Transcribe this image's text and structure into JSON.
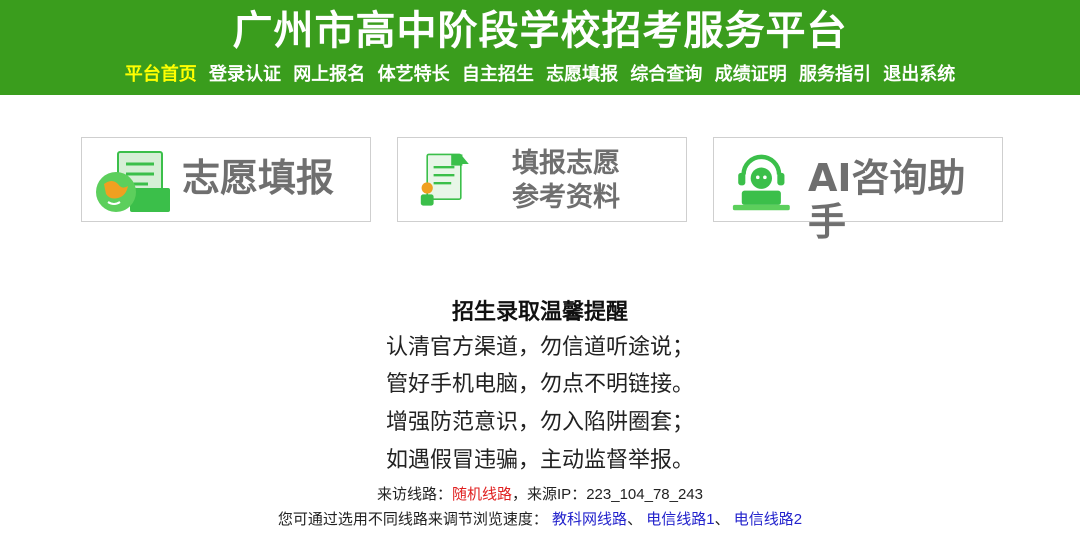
{
  "header": {
    "title": "广州市高中阶段学校招考服务平台",
    "nav": [
      {
        "label": "平台首页",
        "active": true
      },
      {
        "label": "登录认证"
      },
      {
        "label": "网上报名"
      },
      {
        "label": "体艺特长"
      },
      {
        "label": "自主招生"
      },
      {
        "label": "志愿填报"
      },
      {
        "label": "综合查询"
      },
      {
        "label": "成绩证明"
      },
      {
        "label": "服务指引"
      },
      {
        "label": "退出系统"
      }
    ]
  },
  "cards": [
    {
      "label": "志愿填报",
      "icon": "globe-folder-icon"
    },
    {
      "line1": "填报志愿",
      "line2": "参考资料",
      "icon": "document-person-icon"
    },
    {
      "label": "AI咨询助手",
      "icon": "ai-assistant-icon"
    }
  ],
  "notice": {
    "title": "招生录取温馨提醒",
    "lines": [
      "认清官方渠道，勿信道听途说；",
      "管好手机电脑，勿点不明链接。",
      "增强防范意识，勿入陷阱圈套；",
      "如遇假冒违骗，主动监督举报。"
    ]
  },
  "footer": {
    "route_prefix": "来访线路：",
    "route_value": "随机线路",
    "ip_prefix": "，来源IP：",
    "ip_value": "223_104_78_243",
    "speed_text": "您可通过选用不同线路来调节浏览速度：",
    "links": [
      "教科网线路",
      "电信线路1",
      "电信线路2"
    ],
    "separator": "、"
  },
  "colors": {
    "header_bg": "#3a9d1d",
    "nav_active": "#ffff00",
    "icon_green": "#3bbf4a",
    "route_red": "#e02020",
    "link_blue": "#2222cc"
  }
}
